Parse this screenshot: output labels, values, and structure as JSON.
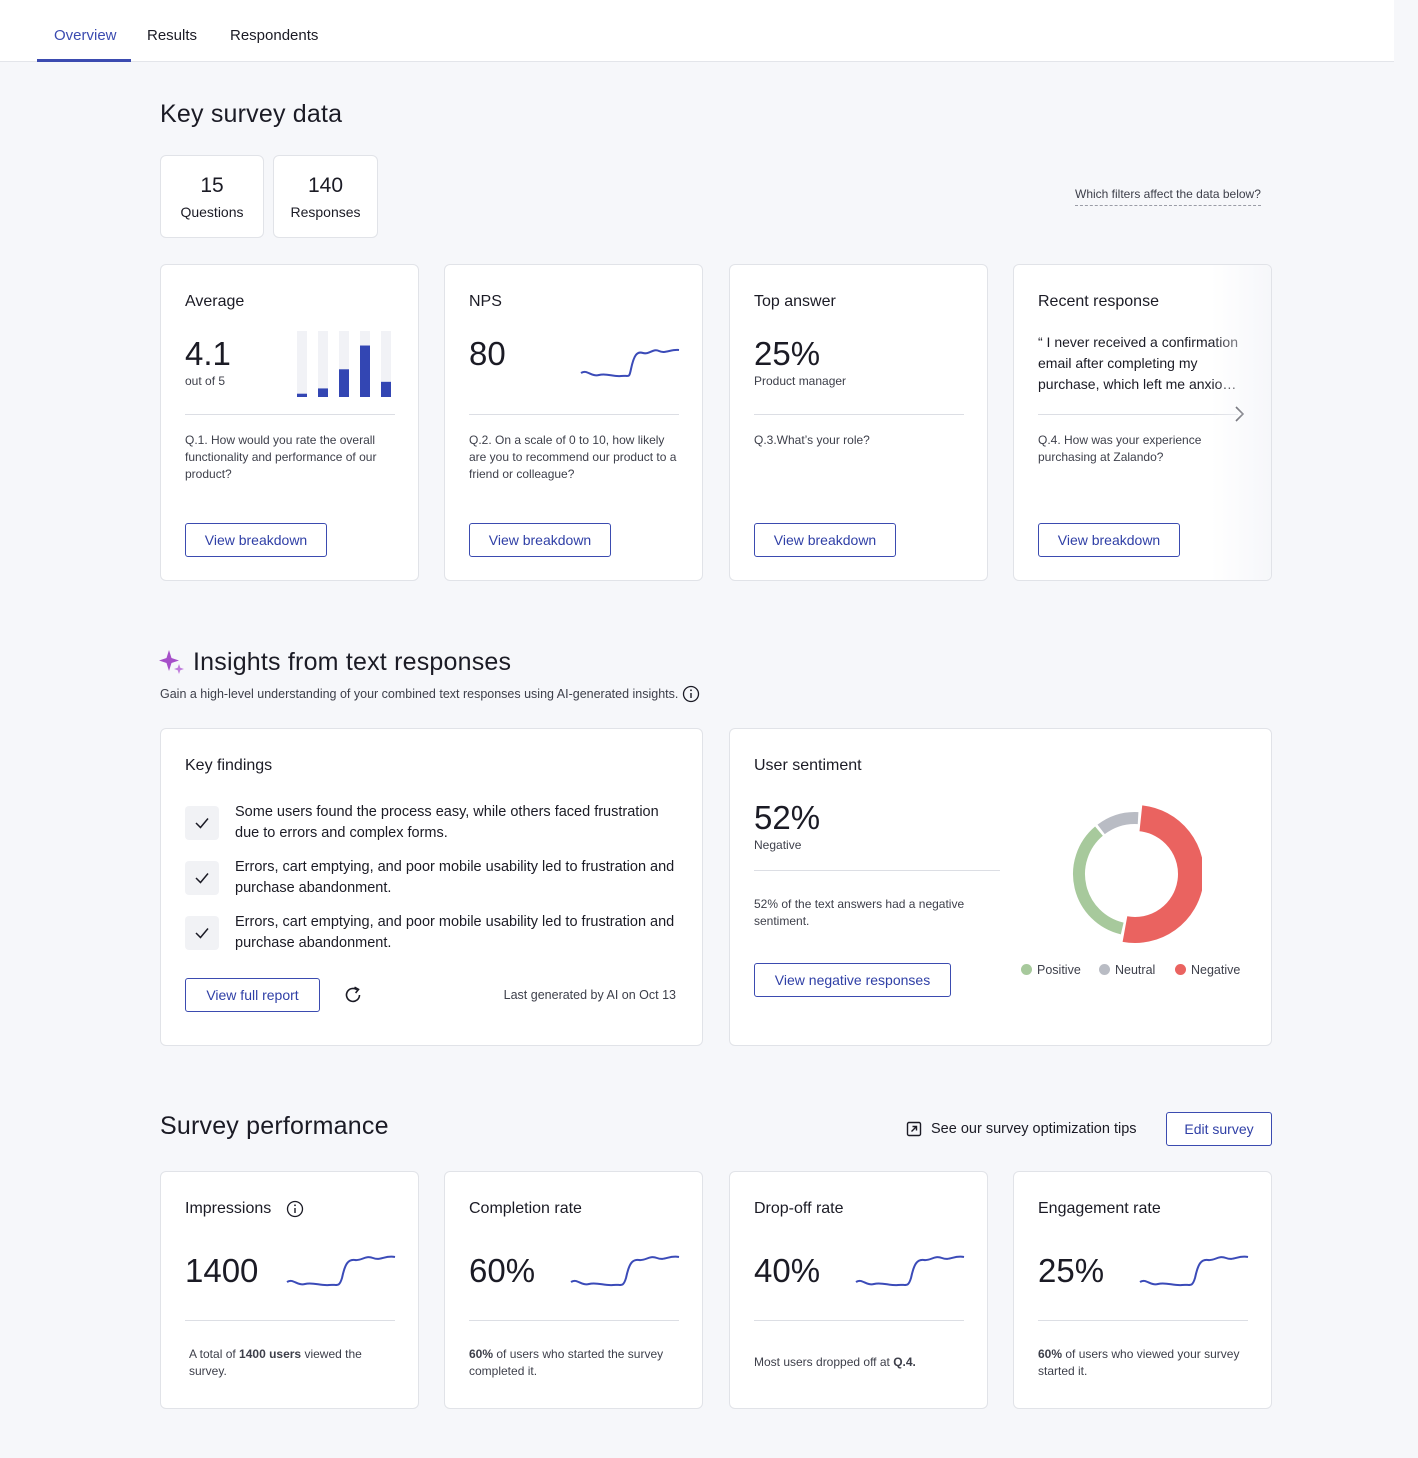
{
  "tabs": [
    {
      "label": "Overview",
      "active": true
    },
    {
      "label": "Results",
      "active": false
    },
    {
      "label": "Respondents",
      "active": false
    }
  ],
  "key_data": {
    "title": "Key survey data",
    "stats": [
      {
        "value": "15",
        "label": "Questions"
      },
      {
        "value": "140",
        "label": "Responses"
      }
    ],
    "filters_link": "Which filters affect the data below?",
    "cards": [
      {
        "title": "Average",
        "value": "4.1",
        "sub": "out of 5",
        "question": "Q.1. How would you rate the overall functionality and performance of our product?",
        "button": "View breakdown",
        "bar_levels": [
          0.05,
          0.13,
          0.42,
          0.78,
          0.23
        ]
      },
      {
        "title": "NPS",
        "value": "80",
        "question": "Q.2. On a scale of 0 to 10, how likely are you to recommend our product to a friend or colleague?",
        "button": "View breakdown"
      },
      {
        "title": "Top answer",
        "value": "25%",
        "sub": "Product manager",
        "question": "Q.3.What’s your role?",
        "button": "View breakdown"
      },
      {
        "title": "Recent response",
        "quote": "“ I never received a confirmation email after completing my purchase, which left me anxio…",
        "question": "Q.4. How was your experience purchasing at Zalando?",
        "button": "View breakdown"
      }
    ]
  },
  "insights": {
    "title": "Insights from text responses",
    "subtitle": "Gain a high-level understanding of your combined text responses using AI-generated insights.",
    "key_findings": {
      "title": "Key findings",
      "items": [
        "Some users found the process easy, while others faced frustration due to errors and complex forms.",
        "Errors, cart emptying, and poor mobile usability led to frustration and purchase abandonment.",
        "Errors, cart emptying, and poor mobile usability led to frustration and purchase abandonment."
      ],
      "button": "View full report",
      "generated": "Last generated by AI on Oct 13"
    },
    "sentiment": {
      "title": "User sentiment",
      "value": "52%",
      "sub": "Negative",
      "description": "52% of the text answers had a negative sentiment.",
      "button": "View negative responses",
      "chart": {
        "segments": [
          {
            "label": "Negative",
            "share": 0.52,
            "color": "#ea6360"
          },
          {
            "label": "Positive",
            "share": 0.36,
            "color": "#a7c99c"
          },
          {
            "label": "Neutral",
            "share": 0.12,
            "color": "#b9bcc4"
          }
        ]
      },
      "legend": [
        {
          "label": "Positive",
          "color": "#a7c99c"
        },
        {
          "label": "Neutral",
          "color": "#b9bcc4"
        },
        {
          "label": "Negative",
          "color": "#ea6360"
        }
      ]
    }
  },
  "performance": {
    "title": "Survey performance",
    "tips_link": "See our survey optimization tips",
    "edit_button": "Edit survey",
    "cards": [
      {
        "title": "Impressions",
        "value": "1400",
        "desc_pre": "A total of ",
        "desc_bold": "1400 users",
        "desc_post": " viewed the survey."
      },
      {
        "title": "Completion rate",
        "value": "60%",
        "desc_pre": "",
        "desc_bold": "60%",
        "desc_post": " of users who started the survey completed it."
      },
      {
        "title": "Drop-off rate",
        "value": "40%",
        "desc_pre": "Most users dropped off at ",
        "desc_bold": "Q.4.",
        "desc_post": ""
      },
      {
        "title": "Engagement rate",
        "value": "25%",
        "desc_pre": "",
        "desc_bold": "60%",
        "desc_post": " of users who viewed your survey started it."
      }
    ]
  },
  "colors": {
    "accent": "#3b4bb0",
    "bar": "#3346b3",
    "sparkline": "#3b4bb8",
    "sparkle": "#a64fc9"
  }
}
